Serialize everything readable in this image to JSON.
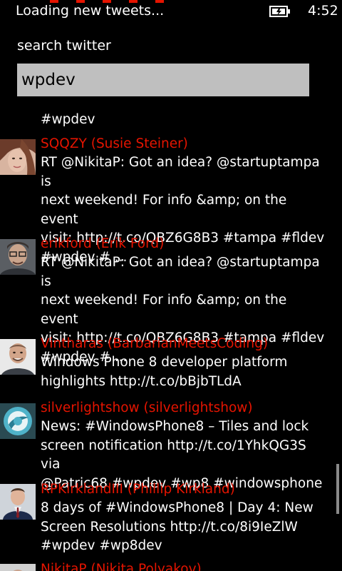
{
  "status_bar": {
    "loading_text": "Loading new tweets...",
    "time": "4:52",
    "battery_icon": "battery-charging-icon"
  },
  "search": {
    "label": "search twitter",
    "value": "wpdev"
  },
  "tweets": [
    {
      "text": "#wpdev"
    },
    {
      "author": "SQQZY (Susie Steiner)",
      "text": "RT @NikitaP: Got an idea? @startuptampa is\nnext weekend! For info &amp; on the event\nvisit: http://t.co/QBZ6G8B3  #tampa #fldev\n#wpdev # ..."
    },
    {
      "author": "erikford (Erik Ford)",
      "text": "RT @NikitaP: Got an idea? @startuptampa is\nnext weekend! For info &amp; on the event\nvisit: http://t.co/QBZ6G8B3  #tampa #fldev\n#wpdev # ..."
    },
    {
      "author": "Vintharas (BarbarianMeetsCoding)",
      "text": "Windows Phone 8 developer platform\nhighlights http://t.co/bBjbTLdA"
    },
    {
      "author": "silverlightshow (silverlightshow)",
      "text": "News: #WindowsPhone8 – Tiles and lock\nscreen notification http://t.co/1YhkQG3S via\n@Patric68 #wpdev #wp8 #windowsphone"
    },
    {
      "author": "RPKirklandIII (Phillip Kirkland)",
      "text": "8 days of #WindowsPhone8 | Day 4: New\nScreen Resolutions http://t.co/8i9IeZlW\n#wpdev #wp8dev"
    },
    {
      "author": "NikitaP (Nikita Polyakov)"
    }
  ],
  "colors": {
    "accent": "#e51400",
    "background": "#000000",
    "input_bg": "#bfbfbf"
  }
}
